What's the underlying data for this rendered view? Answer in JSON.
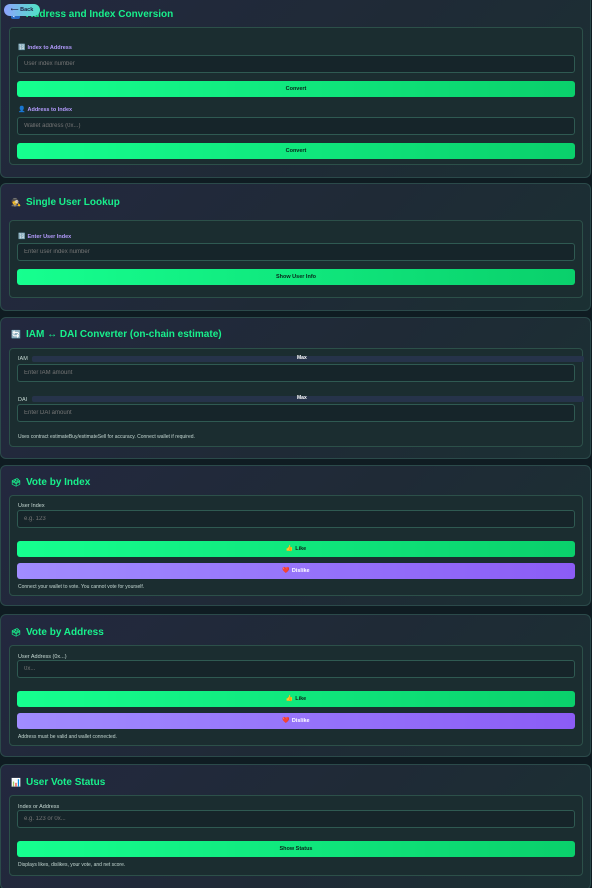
{
  "nav": {
    "back_label": "⟵ Back"
  },
  "address_index": {
    "title": "Address and Index Conversion",
    "index_label": "Index to Address",
    "index_placeholder": "User index number",
    "convert1": "Convert",
    "address_label": "Address to Index",
    "address_placeholder": "Wallet address (0x...)",
    "convert2": "Convert"
  },
  "single_lookup": {
    "title": "Single User Lookup",
    "label": "Enter User Index",
    "placeholder": "Enter user index number",
    "button": "Show User Info"
  },
  "converter": {
    "title": "IAM ↔ DAI Converter (on-chain estimate)",
    "iam_label": "IAM",
    "max_label": "Max",
    "iam_placeholder": "Enter IAM amount",
    "dai_label": "DAI",
    "dai_max_label": "Max",
    "dai_placeholder": "Enter DAI amount",
    "note": "Uses contract estimateBuy/estimateSell for accuracy. Connect wallet if required."
  },
  "vote_index": {
    "title": "Vote by Index",
    "label": "User Index",
    "placeholder": "e.g. 123",
    "like": "Like",
    "dislike": "Dislike",
    "note": "Connect your wallet to vote. You cannot vote for yourself."
  },
  "vote_address": {
    "title": "Vote by Address",
    "label": "User Address (0x...)",
    "placeholder": "0x...",
    "like": "Like",
    "dislike": "Dislike",
    "note": "Address must be valid and wallet connected."
  },
  "vote_status": {
    "title": "User Vote Status",
    "label": "Index or Address",
    "placeholder": "e.g. 123 or 0x...",
    "button": "Show Status",
    "note": "Displays likes, dislikes, your vote, and net score."
  },
  "colors": {
    "accent_green": "#18f08c",
    "accent_purple": "#8b5cf6",
    "label_purple": "#b59cff"
  }
}
